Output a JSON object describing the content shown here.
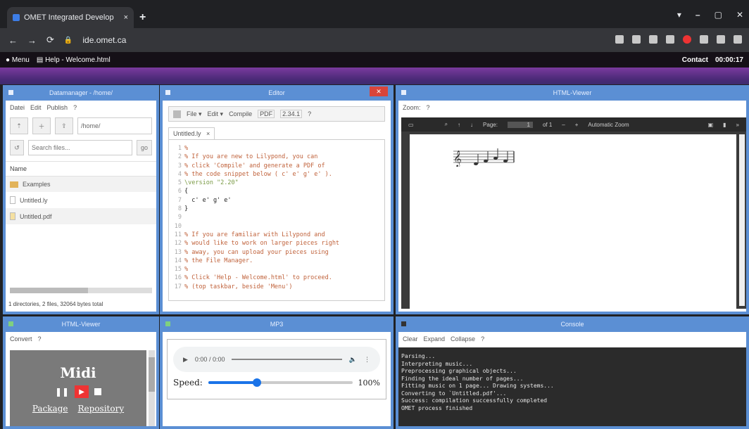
{
  "browser": {
    "tab_title": "OMET Integrated Develop",
    "tab_close": "×",
    "new_tab": "+",
    "url": "ide.omet.ca"
  },
  "taskbar": {
    "menu": "Menu",
    "file": "Help - Welcome.html",
    "contact": "Contact",
    "clock": "00:00:17"
  },
  "filemanager": {
    "title": "Datamanager - /home/",
    "menu": [
      "Datei",
      "Edit",
      "Publish",
      "?"
    ],
    "path": "/home/",
    "search_placeholder": "Search files...",
    "go": "go",
    "name_header": "Name",
    "items": [
      "Examples",
      "Untitled.ly",
      "Untitled.pdf"
    ],
    "status": "1 directories, 2 files, 32064 bytes total"
  },
  "editor": {
    "title": "Editor",
    "close": "✕",
    "toolbar": {
      "file": "File ▾",
      "edit": "Edit ▾",
      "compile": "Compile",
      "format": "PDF",
      "version": "2.34.1",
      "help": "?"
    },
    "tab": "Untitled.ly",
    "tab_close": "×",
    "lines": [
      "%",
      "% If you are new to Lilypond, you can",
      "% click 'Compile' and generate a PDF of",
      "% the code snippet below ( c' e' g' e' ).",
      "\\version \"2.20\"",
      "{",
      "  c' e' g' e'",
      "}",
      "",
      "",
      "% If you are familiar with Lilypond and",
      "% would like to work on larger pieces right",
      "% away, you can upload your pieces using",
      "% the File Manager.",
      "%",
      "% Click 'Help - Welcome.html' to proceed.",
      "% (top taskbar, beside 'Menu')",
      ""
    ],
    "line_numbers": [
      "1",
      "2",
      "3",
      "4",
      "5",
      "6",
      "7",
      "8",
      "9",
      "10",
      "11",
      "12",
      "13",
      "14",
      "15",
      "16",
      "17"
    ]
  },
  "viewer": {
    "title": "HTML-Viewer",
    "zoom": "Zoom:",
    "zoom_help": "?",
    "page_label": "Page:",
    "page": "1",
    "of": "of 1",
    "zoom_mode": "Automatic Zoom"
  },
  "viewer2": {
    "title": "HTML-Viewer",
    "menu": [
      "Convert",
      "?"
    ],
    "midi": "Midi",
    "package": "Package",
    "repository": "Repository"
  },
  "mp3": {
    "title": "MP3",
    "time": "0:00 / 0:00",
    "speed_label": "Speed:",
    "speed_value": "100%",
    "speed_fraction": 0.34
  },
  "console": {
    "title": "Console",
    "menu": [
      "Clear",
      "Expand",
      "Collapse",
      "?"
    ],
    "lines": [
      "Parsing...",
      "Interpreting music...",
      "Preprocessing graphical objects...",
      "Finding the ideal number of pages...",
      "Fitting music on 1 page... Drawing systems...",
      "Converting to `Untitled.pdf'...",
      "Success: compilation successfully completed",
      "OMET process finished"
    ]
  },
  "colors": {
    "window_border": "#5b8fd4",
    "editor_close": "#d9453b",
    "accent": "#3d7ee8",
    "console_bg": "#2b2b2b"
  }
}
